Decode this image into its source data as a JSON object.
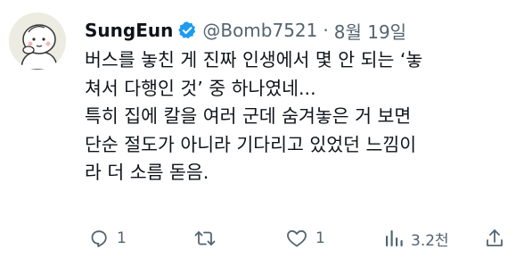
{
  "tweet": {
    "author": {
      "display_name": "SungEun",
      "handle": "@Bomb7521",
      "verified": true
    },
    "separator": "·",
    "date": "8월 19일",
    "text": "버스를 놓친 게 진짜 인생에서 몇 안 되는 ‘놓\n쳐서 다행인 것’ 중 하나였네...\n특히 집에 칼을 여러 군데 숨겨놓은 거 보면\n단순 절도가 아니라 기다리고 있었던 느낌이\n라 더 소름 돋음."
  },
  "actions": {
    "reply": {
      "icon": "reply-icon",
      "count": "1"
    },
    "retweet": {
      "icon": "retweet-icon",
      "count": ""
    },
    "like": {
      "icon": "heart-icon",
      "count": "1"
    },
    "views": {
      "icon": "views-icon",
      "count": "3.2천"
    },
    "share": {
      "icon": "share-icon"
    }
  },
  "colors": {
    "text": "#0f1419",
    "secondary": "#536471",
    "verified": "#1d9bf0"
  }
}
